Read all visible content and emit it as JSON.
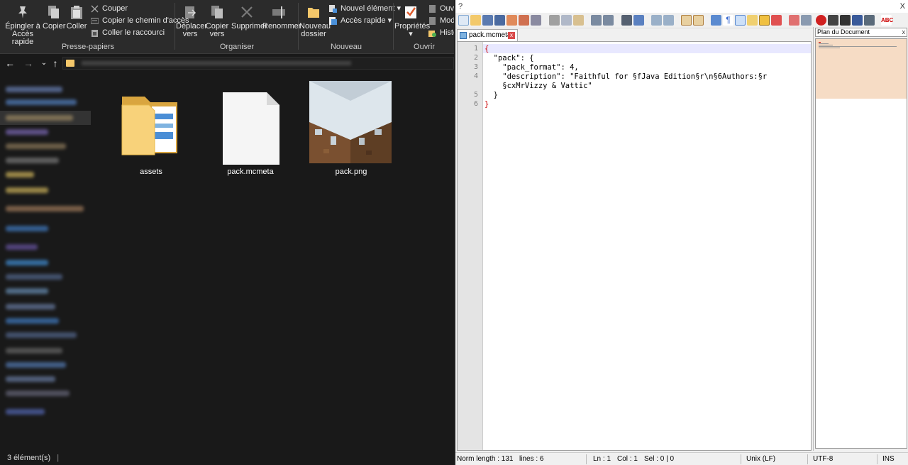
{
  "explorer": {
    "ribbon": {
      "clipboard_group": {
        "title": "Presse-papiers",
        "pin_label_1": "Épingler à",
        "pin_label_2": "Accès rapide",
        "copy": "Copier",
        "paste": "Coller",
        "cut": "Couper",
        "copy_path": "Copier le chemin d'accès",
        "paste_shortcut": "Coller le raccourci"
      },
      "organize_group": {
        "title": "Organiser",
        "move_to_1": "Déplacer",
        "move_to_2": "vers",
        "copy_to_1": "Copier",
        "copy_to_2": "vers",
        "delete": "Supprimer",
        "rename": "Renommer"
      },
      "new_group": {
        "title": "Nouveau",
        "new_folder_1": "Nouveau",
        "new_folder_2": "dossier",
        "new_item": "Nouvel élément",
        "quick_access": "Accès rapide"
      },
      "open_group": {
        "title": "Ouvrir",
        "properties": "Propriétés",
        "open": "Ouvri",
        "edit": "Modi",
        "history": "Histor"
      }
    },
    "files": [
      {
        "name": "assets",
        "kind": "folder"
      },
      {
        "name": "pack.mcmeta",
        "kind": "document"
      },
      {
        "name": "pack.png",
        "kind": "image"
      }
    ],
    "status": "3 élément(s)"
  },
  "notepad": {
    "title_help": "?",
    "title_close": "X",
    "tab_label": "pack.mcmeta",
    "line_numbers": [
      "1",
      "2",
      "3",
      "4",
      "",
      "5",
      "6"
    ],
    "code_lines": [
      "{",
      "  \"pack\": {",
      "    \"pack_format\": 4,",
      "    \"description\": \"Faithful for §fJava Edition§r\\n§6Authors:§r",
      "    §cxMrVizzy & Vattic\"",
      "  }",
      "}"
    ],
    "doc_map_title": "Plan du Document",
    "doc_map_close": "x",
    "status": {
      "length": "Norm length : 131",
      "lines": "lines : 6",
      "ln": "Ln : 1",
      "col": "Col : 1",
      "sel": "Sel : 0 | 0",
      "eol": "Unix (LF)",
      "encoding": "UTF-8",
      "mode": "INS"
    }
  }
}
